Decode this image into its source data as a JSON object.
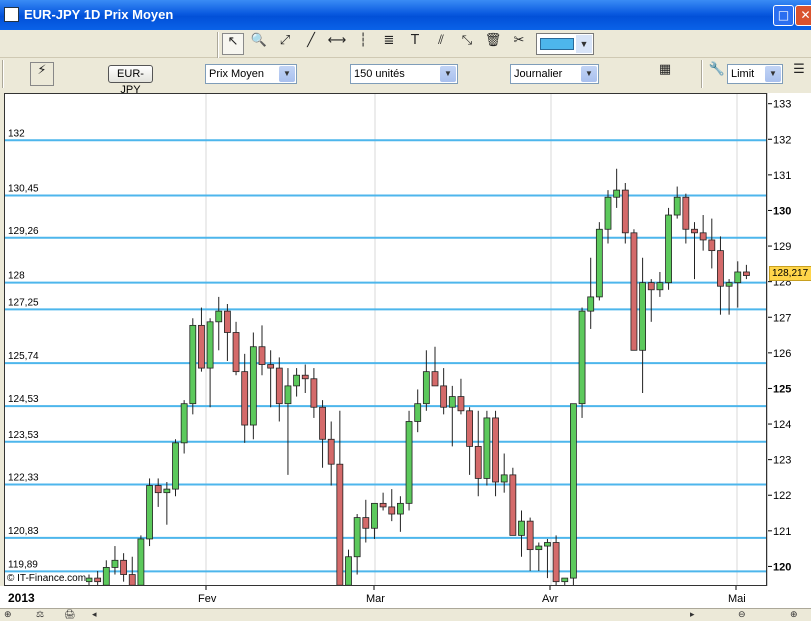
{
  "window": {
    "title": "EUR-JPY 1D Prix Moyen",
    "maximize_glyph": "□",
    "close_glyph": "✕"
  },
  "toolbar1": {
    "tools": [
      {
        "name": "pointer-icon",
        "glyph": "↖",
        "active": true
      },
      {
        "name": "zoom-icon",
        "glyph": "🔍"
      },
      {
        "name": "line-segment-icon",
        "glyph": "⤢"
      },
      {
        "name": "trendline-icon",
        "glyph": "╱"
      },
      {
        "name": "horizontal-line-icon",
        "glyph": "⟷"
      },
      {
        "name": "vertical-line-icon",
        "glyph": "┆"
      },
      {
        "name": "fibonacci-icon",
        "glyph": "≣"
      },
      {
        "name": "text-tool-icon",
        "glyph": "T"
      },
      {
        "name": "parallel-channel-icon",
        "glyph": "⫽"
      },
      {
        "name": "expand-line-icon",
        "glyph": "⤡"
      },
      {
        "name": "trash-icon",
        "glyph": "🗑"
      },
      {
        "name": "tools-icon",
        "glyph": "✂"
      }
    ],
    "color_value": "#4db6ec"
  },
  "toolbar2": {
    "pair_button": "EUR-JPY",
    "price_type": "Prix Moyen",
    "units": "150 unités",
    "period": "Journalier",
    "order_type": "Limit"
  },
  "chart_data": {
    "type": "candlestick",
    "title": "EUR-JPY 1D Prix Moyen",
    "y_ticks": [
      "133",
      "132",
      "131",
      "130",
      "129",
      "128",
      "127",
      "126",
      "125",
      "124",
      "123",
      "122",
      "121",
      "120"
    ],
    "ylim": [
      119.45,
      133.3
    ],
    "x_labels": [
      "2013",
      "Fev",
      "Mar",
      "Avr",
      "Mai"
    ],
    "current_price": "128,217",
    "horizontal_levels": [
      {
        "label": "132",
        "value": 132.0
      },
      {
        "label": "130,45",
        "value": 130.45
      },
      {
        "label": "129,26",
        "value": 129.26
      },
      {
        "label": "128",
        "value": 128.0
      },
      {
        "label": "127,25",
        "value": 127.25
      },
      {
        "label": "125,74",
        "value": 125.74
      },
      {
        "label": "124,53",
        "value": 124.53
      },
      {
        "label": "123,53",
        "value": 123.53
      },
      {
        "label": "122,33",
        "value": 122.33
      },
      {
        "label": "120,83",
        "value": 120.83
      },
      {
        "label": "119,89",
        "value": 119.89
      }
    ],
    "level_color": "#4db6ec",
    "up_color": "#5cc95c",
    "down_color": "#d46a6a",
    "candles": [
      [
        119.6,
        119.8,
        119.5,
        119.7
      ],
      [
        119.7,
        119.9,
        119.5,
        119.6
      ],
      [
        119.5,
        120.2,
        119.4,
        120.0
      ],
      [
        120.0,
        120.6,
        119.8,
        120.2
      ],
      [
        120.2,
        120.4,
        119.6,
        119.8
      ],
      [
        119.8,
        120.3,
        119.5,
        119.5
      ],
      [
        119.5,
        120.9,
        119.4,
        120.8
      ],
      [
        120.8,
        122.5,
        120.6,
        122.3
      ],
      [
        122.3,
        122.5,
        121.7,
        122.1
      ],
      [
        122.1,
        122.4,
        121.2,
        122.2
      ],
      [
        122.2,
        123.6,
        122.0,
        123.5
      ],
      [
        123.5,
        124.7,
        123.2,
        124.6
      ],
      [
        124.6,
        127.0,
        124.3,
        126.8
      ],
      [
        126.8,
        127.3,
        125.5,
        125.6
      ],
      [
        125.6,
        127.0,
        124.5,
        126.9
      ],
      [
        126.9,
        127.6,
        126.1,
        127.2
      ],
      [
        127.2,
        127.4,
        125.8,
        126.6
      ],
      [
        126.6,
        126.9,
        125.4,
        125.5
      ],
      [
        125.5,
        126.0,
        123.5,
        124.0
      ],
      [
        124.0,
        126.6,
        123.6,
        126.2
      ],
      [
        126.2,
        126.8,
        125.4,
        125.7
      ],
      [
        125.7,
        126.1,
        124.5,
        125.6
      ],
      [
        125.6,
        125.9,
        124.1,
        124.6
      ],
      [
        124.6,
        125.6,
        122.6,
        125.1
      ],
      [
        125.1,
        125.6,
        124.8,
        125.4
      ],
      [
        125.4,
        125.7,
        124.9,
        125.3
      ],
      [
        125.3,
        125.6,
        124.2,
        124.5
      ],
      [
        124.5,
        124.7,
        122.8,
        123.6
      ],
      [
        123.6,
        124.1,
        122.3,
        122.9
      ],
      [
        122.9,
        124.4,
        119.4,
        119.5
      ],
      [
        119.5,
        120.5,
        119.0,
        120.3
      ],
      [
        120.3,
        121.5,
        119.8,
        121.4
      ],
      [
        121.4,
        121.9,
        120.7,
        121.1
      ],
      [
        121.1,
        121.8,
        120.8,
        121.8
      ],
      [
        121.8,
        122.1,
        121.6,
        121.7
      ],
      [
        121.7,
        122.2,
        121.3,
        121.5
      ],
      [
        121.5,
        122.0,
        121.0,
        121.8
      ],
      [
        121.8,
        124.4,
        121.6,
        124.1
      ],
      [
        124.1,
        125.0,
        123.8,
        124.6
      ],
      [
        124.6,
        126.1,
        124.4,
        125.5
      ],
      [
        125.5,
        126.2,
        125.4,
        125.1
      ],
      [
        125.1,
        125.6,
        124.3,
        124.5
      ],
      [
        124.5,
        125.1,
        123.4,
        124.8
      ],
      [
        124.8,
        125.3,
        124.3,
        124.4
      ],
      [
        124.4,
        124.5,
        122.6,
        123.4
      ],
      [
        123.4,
        124.4,
        122.0,
        122.5
      ],
      [
        122.5,
        124.4,
        122.3,
        124.2
      ],
      [
        124.2,
        124.4,
        122.0,
        122.4
      ],
      [
        122.4,
        123.2,
        122.1,
        122.6
      ],
      [
        122.6,
        122.8,
        121.2,
        120.9
      ],
      [
        120.9,
        121.6,
        120.3,
        121.3
      ],
      [
        121.3,
        121.4,
        119.9,
        120.5
      ],
      [
        120.5,
        120.7,
        119.9,
        120.6
      ],
      [
        120.6,
        120.8,
        119.7,
        120.7
      ],
      [
        120.7,
        120.9,
        119.4,
        119.6
      ],
      [
        119.6,
        119.7,
        119.4,
        119.7
      ],
      [
        119.7,
        124.6,
        119.5,
        124.6
      ],
      [
        124.6,
        127.3,
        124.2,
        127.2
      ],
      [
        127.2,
        128.7,
        126.7,
        127.6
      ],
      [
        127.6,
        129.7,
        127.5,
        129.5
      ],
      [
        129.5,
        130.6,
        129.1,
        130.4
      ],
      [
        130.4,
        131.2,
        130.1,
        130.6
      ],
      [
        130.6,
        130.8,
        129.1,
        129.4
      ],
      [
        129.4,
        129.5,
        126.4,
        126.1
      ],
      [
        126.1,
        128.7,
        124.9,
        128.0
      ],
      [
        128.0,
        128.1,
        126.9,
        127.8
      ],
      [
        127.8,
        128.3,
        127.6,
        128.0
      ],
      [
        128.0,
        130.1,
        127.8,
        129.9
      ],
      [
        129.9,
        130.7,
        129.8,
        130.4
      ],
      [
        130.4,
        130.5,
        129.1,
        129.5
      ],
      [
        129.5,
        129.7,
        128.1,
        129.4
      ],
      [
        129.4,
        129.9,
        128.9,
        129.2
      ],
      [
        129.2,
        129.8,
        128.4,
        128.9
      ],
      [
        128.9,
        129.3,
        127.1,
        127.9
      ],
      [
        127.9,
        128.1,
        127.1,
        128.0
      ],
      [
        128.0,
        128.6,
        127.3,
        128.3
      ],
      [
        128.3,
        128.5,
        128.1,
        128.2
      ]
    ]
  },
  "footer": {
    "copyright": "© IT-Finance.com",
    "status_icons": [
      "zoom-icon",
      "scale-icon",
      "print-icon",
      "left-arrow-icon",
      "right-arrow-icon",
      "zoom-out-icon",
      "zoom-in-icon"
    ]
  }
}
